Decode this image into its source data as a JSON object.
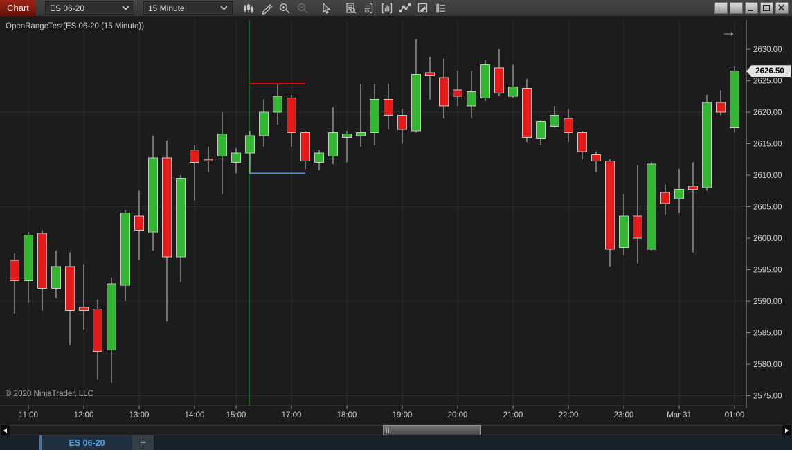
{
  "window": {
    "chart_button": "Chart",
    "instrument_selector": "ES 06-20",
    "interval_selector": "15 Minute"
  },
  "toolbar_icons": [
    "chart-style-icon",
    "drawing-tools-icon",
    "zoom-in-icon",
    "zoom-out-icon",
    "cursor-icon",
    "data-box-icon",
    "panels-icon",
    "indicators-icon",
    "line-tools-icon",
    "chart-properties-icon",
    "list-view-icon"
  ],
  "chart": {
    "indicator_label": "OpenRangeTest(ES 06-20 (15 Minute))",
    "copyright": "© 2020 NinjaTrader, LLC",
    "price_marker": "2626.50",
    "go_to_end_arrow": "→",
    "colors": {
      "background": "#1c1c1c",
      "up": "#33b733",
      "down": "#e51b1b",
      "candle_outline": "#c9c9c9",
      "wick": "#c9c9c9",
      "grid": "#2d2d2d",
      "axis_line": "#8f8f8f",
      "axis_text": "#d6d6d6",
      "session_line": "#0da50d",
      "range_high_line": "#e60000",
      "range_low_line": "#5b8dd6",
      "marker_bg": "#e4e4e4"
    }
  },
  "chart_data": {
    "type": "candlestick",
    "title": "OpenRangeTest(ES 06-20 (15 Minute))",
    "instrument": "ES 06-20",
    "interval": "15 Minute",
    "ylim": [
      2573.4,
      2634.6
    ],
    "y_ticks": [
      2575,
      2580,
      2585,
      2590,
      2595,
      2600,
      2605,
      2610,
      2615,
      2620,
      2625,
      2630
    ],
    "h_grid_levels": [
      2575,
      2590,
      2605,
      2620
    ],
    "x_ticks": [
      {
        "i": 1,
        "label": "11:00"
      },
      {
        "i": 5,
        "label": "12:00"
      },
      {
        "i": 9,
        "label": "13:00"
      },
      {
        "i": 13,
        "label": "14:00"
      },
      {
        "i": 16,
        "label": "15:00"
      },
      {
        "i": 20,
        "label": "17:00"
      },
      {
        "i": 24,
        "label": "18:00"
      },
      {
        "i": 28,
        "label": "19:00"
      },
      {
        "i": 32,
        "label": "20:00"
      },
      {
        "i": 36,
        "label": "21:00"
      },
      {
        "i": 40,
        "label": "22:00"
      },
      {
        "i": 44,
        "label": "23:00"
      },
      {
        "i": 48,
        "label": "Mar 31"
      },
      {
        "i": 52,
        "label": "01:00"
      }
    ],
    "session_break_index": 17,
    "open_range": {
      "high": 2624.5,
      "low": 2610.25,
      "start_index": 17,
      "end_index": 21
    },
    "last_price": 2626.5,
    "ohlc": [
      {
        "t": "10:45",
        "o": 2596.5,
        "h": 2597.5,
        "l": 2588.0,
        "c": 2593.25
      },
      {
        "t": "11:00",
        "o": 2593.25,
        "h": 2601.0,
        "l": 2589.75,
        "c": 2600.5
      },
      {
        "t": "11:15",
        "o": 2600.75,
        "h": 2601.25,
        "l": 2588.5,
        "c": 2592.0
      },
      {
        "t": "11:30",
        "o": 2592.0,
        "h": 2598.0,
        "l": 2590.5,
        "c": 2595.5
      },
      {
        "t": "11:45",
        "o": 2595.5,
        "h": 2597.75,
        "l": 2583.0,
        "c": 2588.5
      },
      {
        "t": "12:00",
        "o": 2589.0,
        "h": 2595.75,
        "l": 2585.5,
        "c": 2588.5
      },
      {
        "t": "12:15",
        "o": 2588.75,
        "h": 2590.25,
        "l": 2577.5,
        "c": 2582.0
      },
      {
        "t": "12:30",
        "o": 2582.25,
        "h": 2593.75,
        "l": 2577.0,
        "c": 2592.75
      },
      {
        "t": "12:45",
        "o": 2592.5,
        "h": 2604.5,
        "l": 2590.0,
        "c": 2604.0
      },
      {
        "t": "13:00",
        "o": 2603.5,
        "h": 2607.5,
        "l": 2596.5,
        "c": 2601.25
      },
      {
        "t": "13:15",
        "o": 2601.0,
        "h": 2616.25,
        "l": 2598.0,
        "c": 2612.75
      },
      {
        "t": "13:30",
        "o": 2612.75,
        "h": 2615.5,
        "l": 2586.75,
        "c": 2597.0
      },
      {
        "t": "13:45",
        "o": 2597.0,
        "h": 2610.0,
        "l": 2593.0,
        "c": 2609.5
      },
      {
        "t": "14:00",
        "o": 2614.0,
        "h": 2614.75,
        "l": 2606.0,
        "c": 2612.0
      },
      {
        "t": "14:15",
        "o": 2612.5,
        "h": 2614.5,
        "l": 2610.5,
        "c": 2612.25
      },
      {
        "t": "14:30",
        "o": 2613.0,
        "h": 2620.0,
        "l": 2607.0,
        "c": 2616.5
      },
      {
        "t": "15:00",
        "o": 2612.0,
        "h": 2614.25,
        "l": 2610.25,
        "c": 2613.5
      },
      {
        "t": "15:15",
        "o": 2613.5,
        "h": 2617.0,
        "l": 2610.25,
        "c": 2616.25
      },
      {
        "t": "15:30",
        "o": 2616.25,
        "h": 2622.0,
        "l": 2614.5,
        "c": 2620.0
      },
      {
        "t": "15:45",
        "o": 2620.0,
        "h": 2624.5,
        "l": 2618.0,
        "c": 2622.5
      },
      {
        "t": "17:00",
        "o": 2622.25,
        "h": 2622.75,
        "l": 2614.5,
        "c": 2616.75
      },
      {
        "t": "17:15",
        "o": 2616.75,
        "h": 2617.0,
        "l": 2611.0,
        "c": 2612.25
      },
      {
        "t": "17:30",
        "o": 2612.0,
        "h": 2614.0,
        "l": 2610.75,
        "c": 2613.5
      },
      {
        "t": "17:45",
        "o": 2613.0,
        "h": 2620.75,
        "l": 2611.75,
        "c": 2616.75
      },
      {
        "t": "18:00",
        "o": 2616.0,
        "h": 2617.0,
        "l": 2612.0,
        "c": 2616.5
      },
      {
        "t": "18:15",
        "o": 2616.25,
        "h": 2624.5,
        "l": 2614.5,
        "c": 2616.75
      },
      {
        "t": "18:30",
        "o": 2616.75,
        "h": 2624.5,
        "l": 2614.75,
        "c": 2622.0
      },
      {
        "t": "18:45",
        "o": 2622.0,
        "h": 2624.5,
        "l": 2617.25,
        "c": 2619.5
      },
      {
        "t": "19:00",
        "o": 2619.5,
        "h": 2620.5,
        "l": 2615.0,
        "c": 2617.25
      },
      {
        "t": "19:15",
        "o": 2617.0,
        "h": 2631.5,
        "l": 2616.75,
        "c": 2626.0
      },
      {
        "t": "19:30",
        "o": 2626.25,
        "h": 2628.75,
        "l": 2622.0,
        "c": 2625.75
      },
      {
        "t": "19:45",
        "o": 2625.5,
        "h": 2628.5,
        "l": 2619.0,
        "c": 2621.0
      },
      {
        "t": "20:00",
        "o": 2623.5,
        "h": 2626.5,
        "l": 2621.0,
        "c": 2622.5
      },
      {
        "t": "20:15",
        "o": 2621.0,
        "h": 2626.5,
        "l": 2619.0,
        "c": 2623.25
      },
      {
        "t": "20:30",
        "o": 2622.25,
        "h": 2628.25,
        "l": 2621.75,
        "c": 2627.5
      },
      {
        "t": "20:45",
        "o": 2627.0,
        "h": 2630.0,
        "l": 2622.5,
        "c": 2623.0
      },
      {
        "t": "21:00",
        "o": 2622.5,
        "h": 2627.5,
        "l": 2622.25,
        "c": 2624.0
      },
      {
        "t": "21:15",
        "o": 2623.75,
        "h": 2625.25,
        "l": 2615.25,
        "c": 2616.0
      },
      {
        "t": "21:30",
        "o": 2615.75,
        "h": 2618.75,
        "l": 2614.75,
        "c": 2618.5
      },
      {
        "t": "21:45",
        "o": 2617.75,
        "h": 2621.0,
        "l": 2617.5,
        "c": 2619.5
      },
      {
        "t": "22:00",
        "o": 2619.0,
        "h": 2620.5,
        "l": 2615.25,
        "c": 2616.75
      },
      {
        "t": "22:15",
        "o": 2616.75,
        "h": 2617.0,
        "l": 2612.5,
        "c": 2613.75
      },
      {
        "t": "22:30",
        "o": 2613.25,
        "h": 2613.75,
        "l": 2610.5,
        "c": 2612.25
      },
      {
        "t": "22:45",
        "o": 2612.25,
        "h": 2612.5,
        "l": 2595.5,
        "c": 2598.25
      },
      {
        "t": "23:00",
        "o": 2598.5,
        "h": 2607.0,
        "l": 2597.25,
        "c": 2603.5
      },
      {
        "t": "23:15",
        "o": 2603.5,
        "h": 2611.5,
        "l": 2596.0,
        "c": 2600.0
      },
      {
        "t": "23:30",
        "o": 2598.25,
        "h": 2612.0,
        "l": 2598.0,
        "c": 2611.75
      },
      {
        "t": "23:45",
        "o": 2607.25,
        "h": 2608.5,
        "l": 2603.75,
        "c": 2605.5
      },
      {
        "t": "00:00",
        "o": 2606.25,
        "h": 2611.0,
        "l": 2604.0,
        "c": 2607.75
      },
      {
        "t": "00:15",
        "o": 2608.25,
        "h": 2612.0,
        "l": 2597.75,
        "c": 2607.75
      },
      {
        "t": "00:30",
        "o": 2608.0,
        "h": 2622.75,
        "l": 2607.5,
        "c": 2621.5
      },
      {
        "t": "00:45",
        "o": 2621.5,
        "h": 2623.5,
        "l": 2619.5,
        "c": 2620.0
      },
      {
        "t": "01:00",
        "o": 2617.5,
        "h": 2627.25,
        "l": 2616.75,
        "c": 2626.5
      }
    ]
  },
  "tabs": {
    "active": "ES 06-20",
    "add": "+"
  }
}
